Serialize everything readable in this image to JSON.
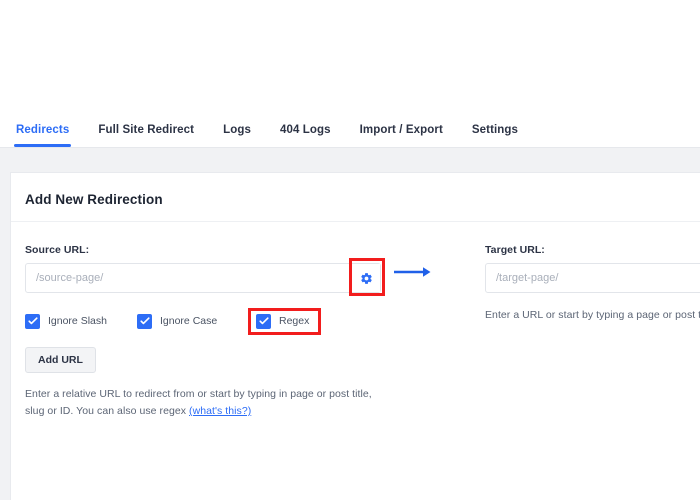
{
  "tabs": [
    {
      "label": "Redirects",
      "active": true
    },
    {
      "label": "Full Site Redirect",
      "active": false
    },
    {
      "label": "Logs",
      "active": false
    },
    {
      "label": "404 Logs",
      "active": false
    },
    {
      "label": "Import / Export",
      "active": false
    },
    {
      "label": "Settings",
      "active": false
    }
  ],
  "card": {
    "title": "Add New Redirection"
  },
  "source": {
    "label": "Source URL:",
    "placeholder": "/source-page/",
    "value": "",
    "gear_icon": "gear-icon",
    "hint_text": "Enter a relative URL to redirect from or start by typing in page or post title, slug or ID. You can also use regex ",
    "hint_link": "(what's this?)"
  },
  "target": {
    "label": "Target URL:",
    "placeholder": "/target-page/",
    "value": "",
    "hint_text": "Enter a URL or start by typing a page or post title"
  },
  "arrow_icon": "arrow-right-icon",
  "checkboxes": [
    {
      "label": "Ignore Slash",
      "checked": true,
      "highlighted": false
    },
    {
      "label": "Ignore Case",
      "checked": true,
      "highlighted": false
    },
    {
      "label": "Regex",
      "checked": true,
      "highlighted": true
    }
  ],
  "buttons": {
    "add_url": "Add URL"
  },
  "colors": {
    "accent_blue": "#2d6df6",
    "highlight_red": "#f21d1d",
    "page_bg": "#f1f2f4",
    "card_bg": "#ffffff",
    "text_dark": "#2c3345",
    "text_muted": "#5c6575"
  }
}
